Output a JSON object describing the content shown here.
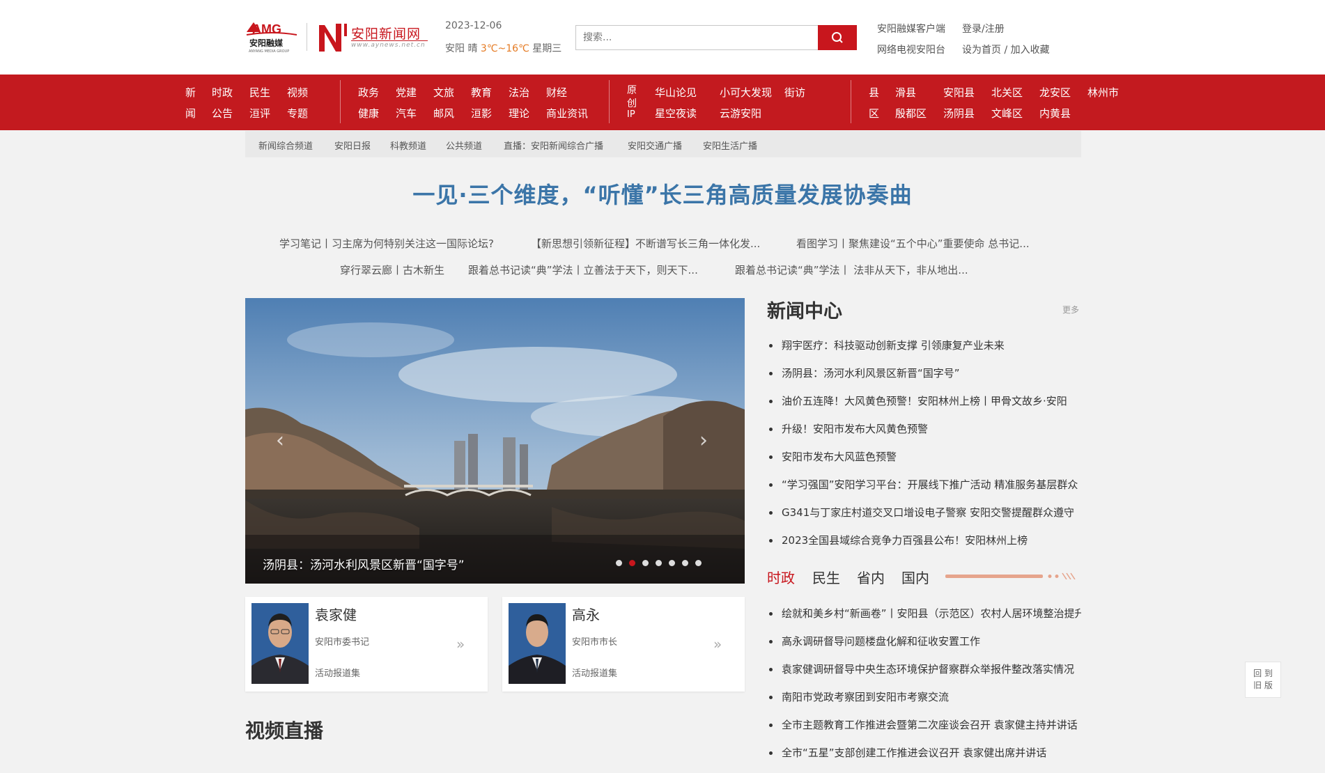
{
  "brand": {
    "amg_cn": "安阳融媒",
    "amg_en": "ANYANG MEDIA GROUP",
    "site_name": "安阳新闻网",
    "site_url": "www.aynews.net.cn"
  },
  "info": {
    "date": "2023-12-06",
    "city": "安阳",
    "weather": "晴",
    "temp": "3℃~16℃",
    "weekday": "星期三"
  },
  "search": {
    "placeholder": "搜索..."
  },
  "toplinks": {
    "client": "安阳融媒客户端",
    "login": "登录/注册",
    "tv": "网络电视安阳台",
    "home": "设为首页 / 加入收藏"
  },
  "nav": {
    "g1_head_top": "新",
    "g1_head_bot": "闻",
    "g1": [
      "时政",
      "民生",
      "视频",
      "公告",
      "洹评",
      "专题"
    ],
    "g2": [
      "政务",
      "党建",
      "文旅",
      "教育",
      "法治",
      "财经",
      "健康",
      "汽车",
      "邮风",
      "洹影",
      "理论",
      "商业资讯"
    ],
    "g3_head": [
      "原",
      "创",
      "IP"
    ],
    "g3": [
      "华山论见",
      "小可大发现",
      "街访",
      "星空夜读",
      "云游安阳"
    ],
    "g4_head_top": "县",
    "g4_head_bot": "区",
    "g4": [
      "滑县",
      "安阳县",
      "北关区",
      "龙安区",
      "林州市",
      "殷都区",
      "汤阴县",
      "文峰区",
      "内黄县"
    ]
  },
  "subnav": [
    "新闻综合频道",
    "安阳日报",
    "科教频道",
    "公共频道",
    "直播：安阳新闻综合广播",
    "安阳交通广播",
    "安阳生活广播"
  ],
  "headline": "一见·三个维度，“听懂”长三角高质量发展协奏曲",
  "headline_links": [
    "学习笔记丨习主席为何特别关注这一国际论坛?",
    "【新思想引领新征程】不断谱写长三角一体化发...",
    "看图学习丨聚焦建设“五个中心”重要使命 总书记...",
    "穿行翠云廊丨古木新生",
    "跟着总书记读“典”学法丨立善法于天下，则天下...",
    "跟着总书记读“典”学法丨 法非从天下，非从地出..."
  ],
  "slider": {
    "caption": "汤阴县：汤河水利风景区新晋“国字号”",
    "prev": "‹",
    "next": "›",
    "dot_count": 7,
    "active_dot": 2
  },
  "leaders": [
    {
      "name": "袁家健",
      "title": "安阳市委书记",
      "link": "活动报道集"
    },
    {
      "name": "高永",
      "title": "安阳市市长",
      "link": "活动报道集"
    }
  ],
  "video_live": "视频直播",
  "news_center": {
    "title": "新闻中心",
    "more": "更多",
    "items": [
      "翔宇医疗：科技驱动创新支撑 引领康复产业未来",
      "汤阴县：汤河水利风景区新晋“国字号”",
      "油价五连降！大风黄色预警！安阳林州上榜丨甲骨文故乡·安阳",
      "升级！安阳市发布大风黄色预警",
      "安阳市发布大风蓝色预警",
      "“学习强国”安阳学习平台：开展线下推广活动 精准服务基层群众",
      "G341与丁家庄村道交叉口增设电子警察 安阳交警提醒群众遵守",
      "2023全国县域综合竞争力百强县公布！安阳林州上榜"
    ]
  },
  "tabs": [
    "时政",
    "民生",
    "省内",
    "国内"
  ],
  "politics": [
    "绘就和美乡村“新画卷”丨安阳县（示范区）农村人居环境整治提升",
    "高永调研督导问题楼盘化解和征收安置工作",
    "袁家健调研督导中央生态环境保护督察群众举报件整改落实情况",
    "南阳市党政考察团到安阳市考察交流",
    "全市主题教育工作推进会暨第二次座谈会召开 袁家健主持并讲话",
    "全市“五星”支部创建工作推进会议召开 袁家健出席并讲话"
  ],
  "backtop": [
    "回 到",
    "旧 版"
  ],
  "colors": {
    "brand_red": "#c31a1f",
    "headline_blue": "#3b75a8",
    "weather_orange": "#e57a22"
  }
}
